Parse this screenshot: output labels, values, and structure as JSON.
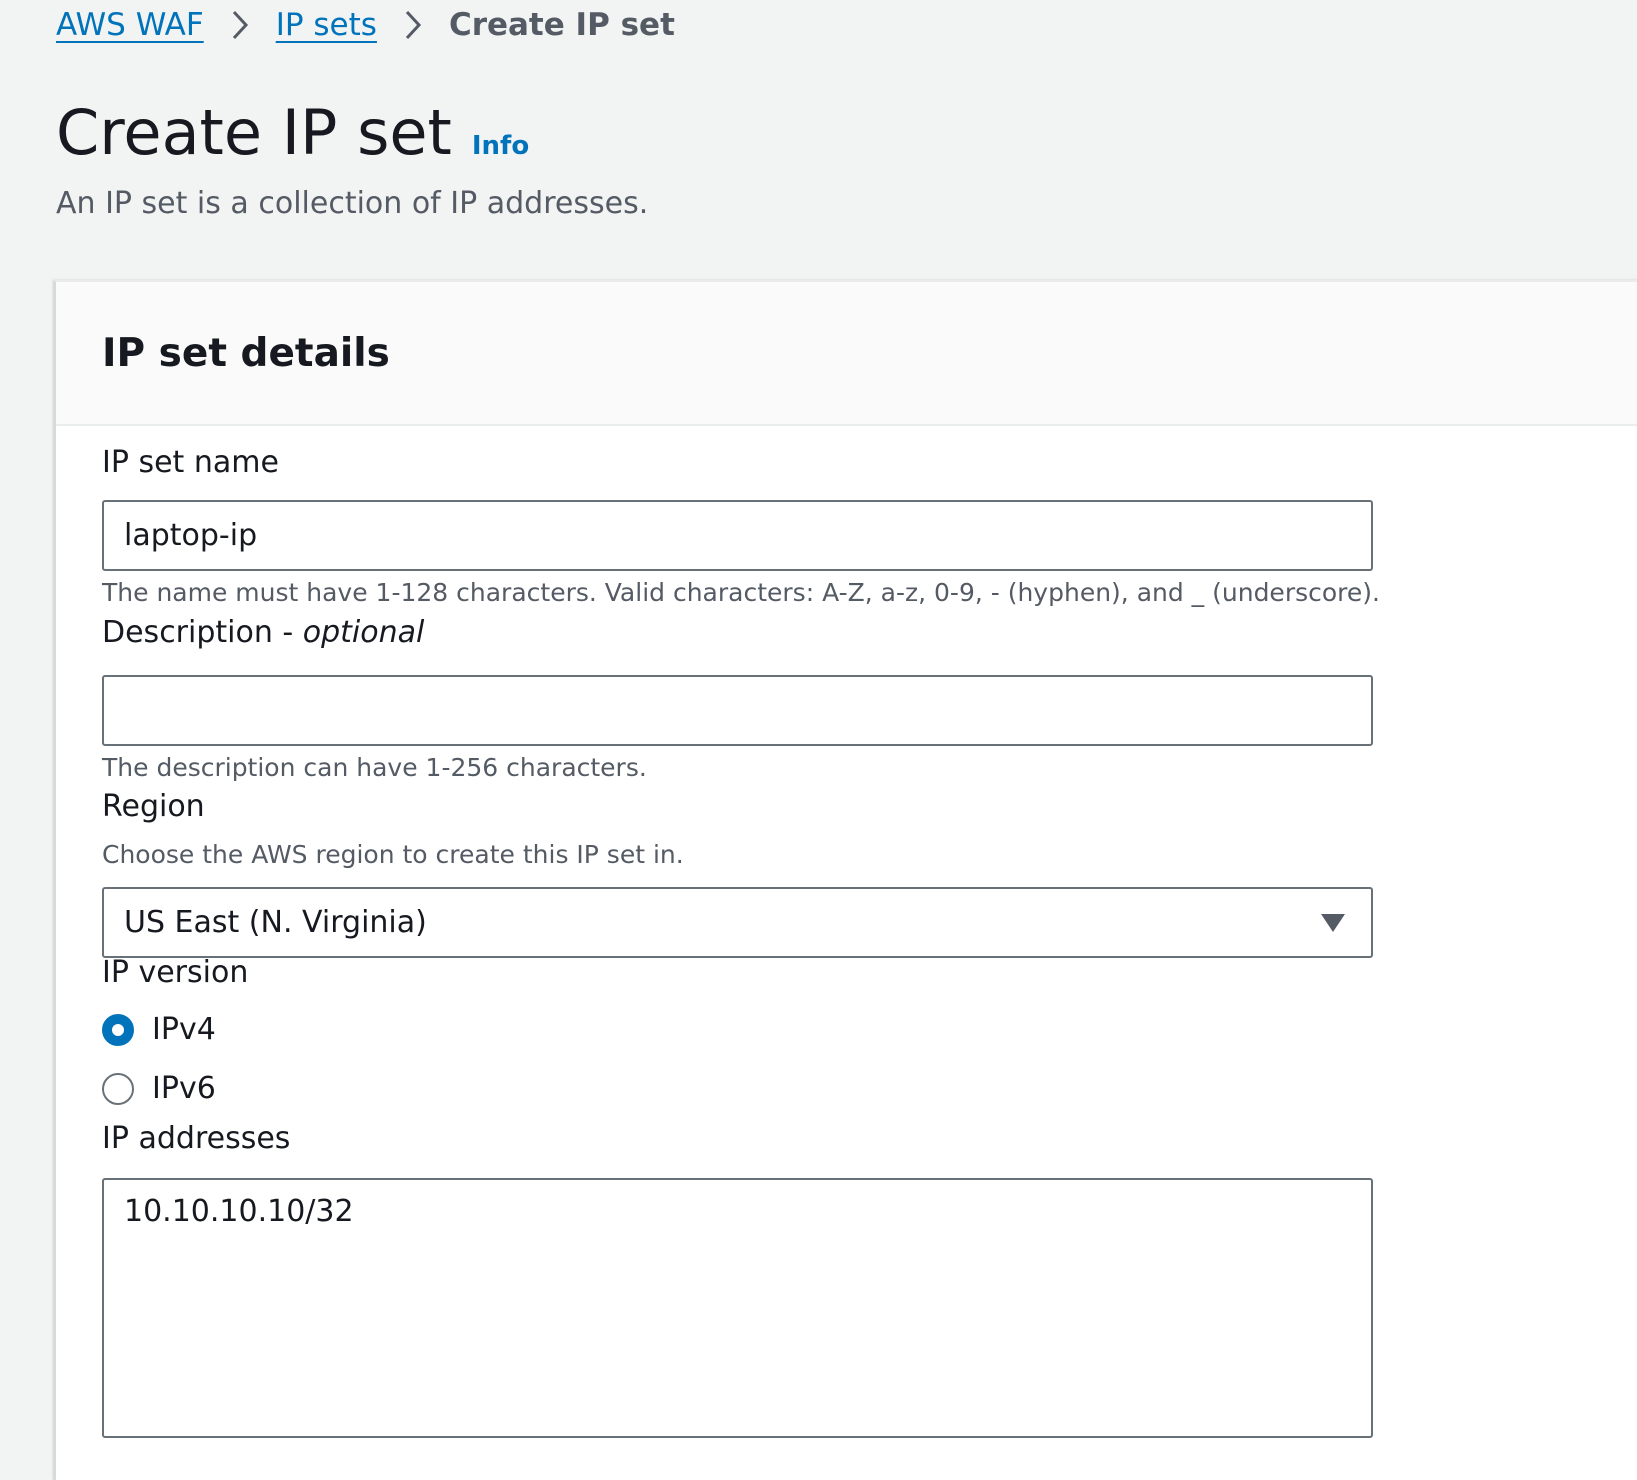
{
  "breadcrumb": {
    "items": [
      {
        "label": "AWS WAF"
      },
      {
        "label": "IP sets"
      }
    ],
    "current": "Create IP set"
  },
  "header": {
    "title": "Create IP set",
    "info_label": "Info",
    "description": "An IP set is a collection of IP addresses."
  },
  "panel": {
    "title": "IP set details",
    "name": {
      "label": "IP set name",
      "value": "laptop-ip",
      "hint": "The name must have 1-128 characters. Valid characters: A-Z, a-z, 0-9, - (hyphen), and _ (underscore)."
    },
    "description": {
      "label": "Description - ",
      "label_optional": "optional",
      "value": "",
      "hint": "The description can have 1-256 characters."
    },
    "region": {
      "label": "Region",
      "hint": "Choose the AWS region to create this IP set in.",
      "selected": "US East (N. Virginia)"
    },
    "ip_version": {
      "label": "IP version",
      "options": [
        {
          "label": "IPv4",
          "checked": true
        },
        {
          "label": "IPv6",
          "checked": false
        }
      ]
    },
    "ip_addresses": {
      "label": "IP addresses",
      "value": "10.10.10.10/32"
    }
  },
  "colors": {
    "link": "#0073bb",
    "page_bg": "#f2f3f3",
    "border": "#687078",
    "muted_text": "#545b64"
  }
}
